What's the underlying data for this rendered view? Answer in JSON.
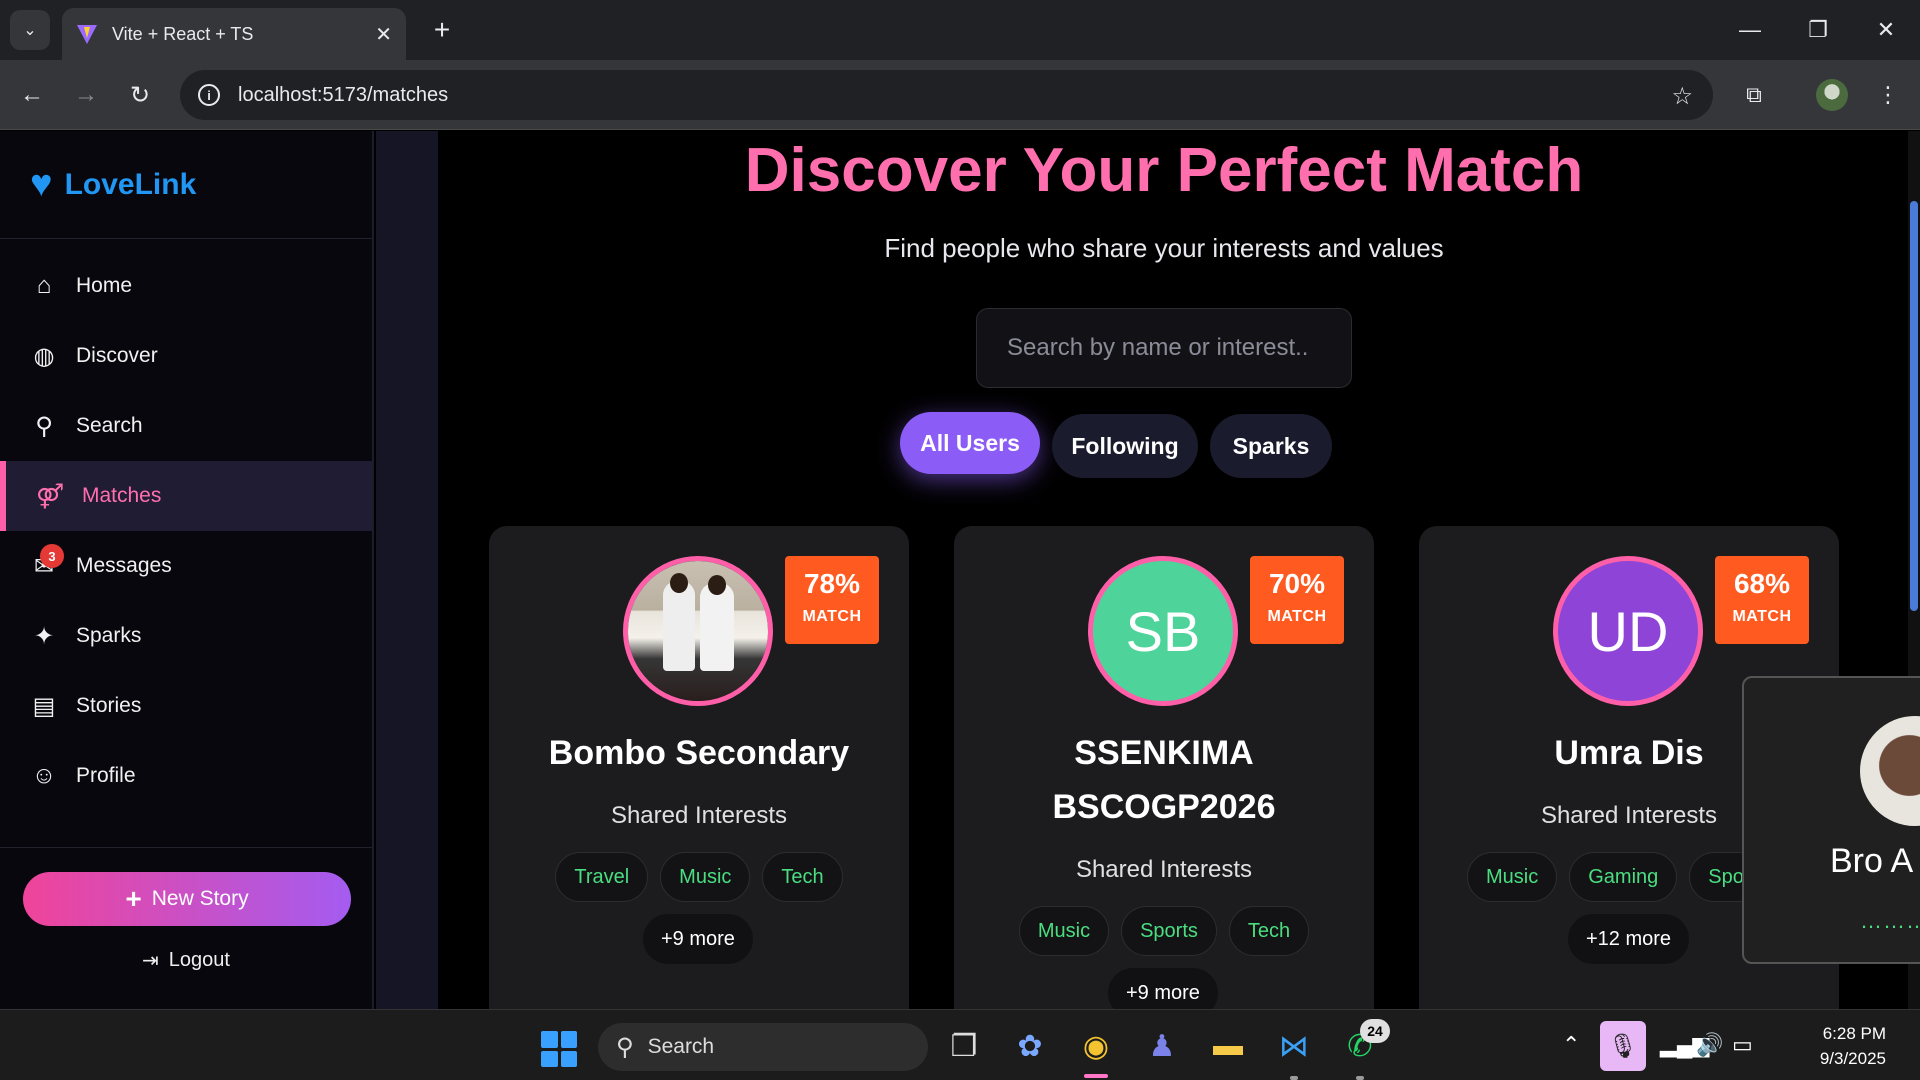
{
  "browser": {
    "tab_title": "Vite + React + TS",
    "tab_close": "✕",
    "new_tab": "+",
    "url": "localhost:5173/matches",
    "controls": {
      "minimize": "—",
      "restore": "❐",
      "close": "✕"
    }
  },
  "app": {
    "brand": "LoveLink",
    "nav": [
      {
        "label": "Home",
        "icon": "home-icon"
      },
      {
        "label": "Discover",
        "icon": "compass-icon"
      },
      {
        "label": "Search",
        "icon": "search-icon"
      },
      {
        "label": "Matches",
        "icon": "couple-icon",
        "active": true
      },
      {
        "label": "Messages",
        "icon": "envelope-icon",
        "badge": "3"
      },
      {
        "label": "Sparks",
        "icon": "sparkle-icon"
      },
      {
        "label": "Stories",
        "icon": "book-icon"
      },
      {
        "label": "Profile",
        "icon": "user-icon"
      }
    ],
    "new_story": "New Story",
    "logout": "Logout"
  },
  "main": {
    "title": "Discover Your Perfect Match",
    "subtitle": "Find people who share your interests and values",
    "search_placeholder": "Search by name or interest..",
    "filters": [
      {
        "label": "All Users",
        "active": true
      },
      {
        "label": "Following"
      },
      {
        "label": "Sparks"
      }
    ],
    "shared_label": "Shared Interests",
    "cards": [
      {
        "name": "Bombo Secondary",
        "match_pct": "78%",
        "match_label": "MATCH",
        "avatar_type": "photo",
        "initials": "",
        "avatar_color": "",
        "tags": [
          "Travel",
          "Music",
          "Tech"
        ],
        "more": "+9 more"
      },
      {
        "name": "SSENKIMA BSCOGP2026",
        "match_pct": "70%",
        "match_label": "MATCH",
        "avatar_type": "initials",
        "initials": "SB",
        "avatar_color": "#4ed39a",
        "tags": [
          "Music",
          "Sports",
          "Tech"
        ],
        "more": "+9 more"
      },
      {
        "name": "Umra Dis",
        "match_pct": "68%",
        "match_label": "MATCH",
        "avatar_type": "initials",
        "initials": "UD",
        "avatar_color": "#8e44d6",
        "tags": [
          "Music",
          "Gaming",
          "Spo"
        ],
        "more": "+12 more"
      }
    ]
  },
  "overlay": {
    "name": "Bro A",
    "status_dots": "………"
  },
  "taskbar": {
    "search_label": "Search",
    "whatsapp_badge": "24",
    "time": "6:28 PM",
    "date": "9/3/2025"
  },
  "colors": {
    "accent_pink": "#ff6fae",
    "accent_purple": "#8b5cf6",
    "match_orange": "#ff5a1f",
    "tag_green": "#4ade80",
    "brand_blue": "#2196f3"
  }
}
